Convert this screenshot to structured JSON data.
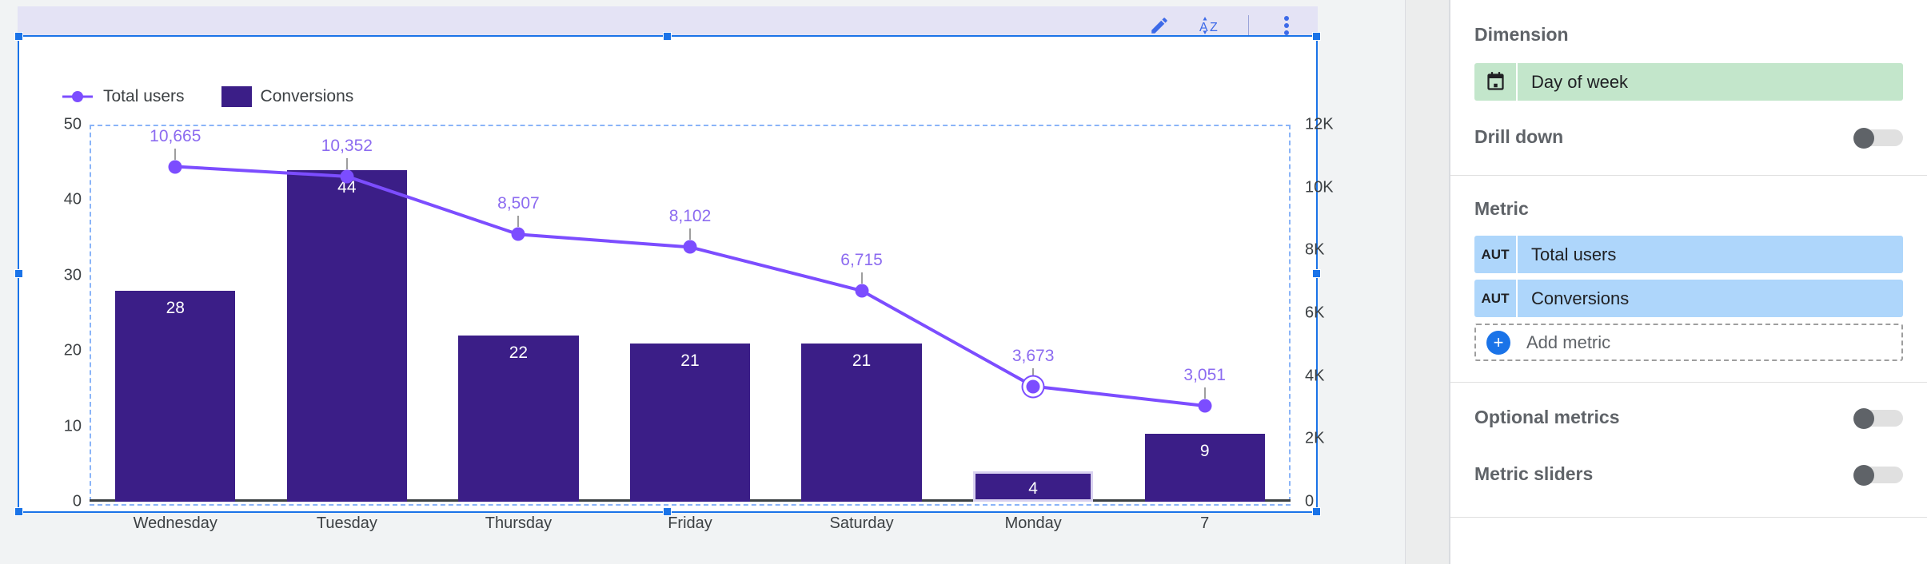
{
  "toolbar": {
    "edit_icon": "pencil-icon",
    "sort_icon": "sort-alpha-icon",
    "sort_label": "AZ",
    "more_icon": "more-vert-icon"
  },
  "chart_data": {
    "type": "bar",
    "title": "",
    "subtitle": "",
    "xlabel": "",
    "ylabel": "",
    "grid": false,
    "legend_position": "top-left",
    "categories": [
      "Wednesday",
      "Tuesday",
      "Thursday",
      "Friday",
      "Saturday",
      "Monday",
      "7"
    ],
    "series": [
      {
        "name": "Total users",
        "type": "line",
        "axis": "right",
        "color": "#7c4dff",
        "values": [
          10665,
          8507,
          8102,
          6715,
          3673,
          3051
        ],
        "point_labels": [
          "10,665",
          "10,352",
          "8,507",
          "8,102",
          "6,715",
          "3,673",
          "3,051"
        ],
        "point_values": [
          10665,
          10352,
          8507,
          8102,
          6715,
          3673,
          3051
        ],
        "highlighted_index": 5
      },
      {
        "name": "Conversions",
        "type": "bar",
        "axis": "left",
        "color": "#3b1e87",
        "values": [
          28,
          44,
          22,
          21,
          21,
          4,
          9
        ],
        "bar_labels": [
          "28",
          "44",
          "22",
          "21",
          "21",
          "4",
          "9"
        ],
        "selected_index": 5
      }
    ],
    "left_axis": {
      "ticks": [
        "0",
        "10",
        "20",
        "30",
        "40",
        "50"
      ],
      "min": 0,
      "max": 50
    },
    "right_axis": {
      "ticks": [
        "0",
        "2K",
        "4K",
        "6K",
        "8K",
        "10K",
        "12K"
      ],
      "min": 0,
      "max": 12000
    }
  },
  "panel": {
    "dimension": {
      "title": "Dimension",
      "chip_label": "Day of week",
      "chip_icon": "calendar-icon",
      "drill_down_label": "Drill down",
      "drill_down_on": false
    },
    "metric": {
      "title": "Metric",
      "items": [
        {
          "badge": "AUT",
          "label": "Total users"
        },
        {
          "badge": "AUT",
          "label": "Conversions"
        }
      ],
      "add_label": "Add metric"
    },
    "options": {
      "optional_metrics_label": "Optional metrics",
      "optional_metrics_on": false,
      "metric_sliders_label": "Metric sliders",
      "metric_sliders_on": false
    }
  },
  "colors": {
    "line": "#7c4dff",
    "bar": "#3b1e87",
    "selection": "#1a73e8",
    "toolbar_band": "#e4e3f5",
    "dimension_chip": "#c3e6cb",
    "metric_chip": "#aed6fb"
  }
}
